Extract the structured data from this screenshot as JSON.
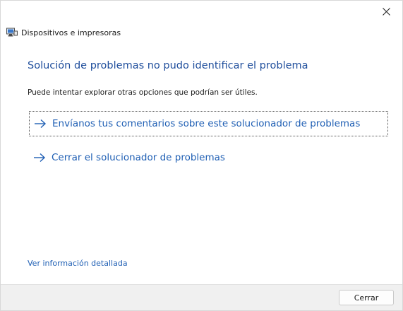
{
  "window": {
    "title": "Dispositivos e impresoras",
    "close_icon": "close-icon",
    "app_icon": "devices-printers-icon"
  },
  "main": {
    "heading": "Solución de problemas no pudo identificar el problema",
    "description": "Puede intentar explorar otras opciones que podrían ser útiles.",
    "options": [
      {
        "label": "Envíanos tus comentarios sobre este solucionador de problemas",
        "icon": "arrow-right-icon",
        "focused": true
      },
      {
        "label": "Cerrar el solucionador de problemas",
        "icon": "arrow-right-icon",
        "focused": false
      }
    ],
    "details_link": "Ver información detallada"
  },
  "footer": {
    "cancel_label": "Cerrar"
  },
  "colors": {
    "heading": "#1f4e9c",
    "link": "#1f5fb4",
    "footer_bg": "#f0f0f0"
  }
}
